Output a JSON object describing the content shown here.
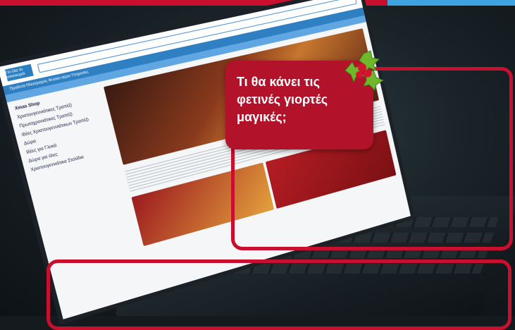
{
  "hero": {
    "headline": "Τι θα κάνει τις φετινές γιορτές μαγικές;"
  },
  "screen": {
    "logo": "Για όλα τα νοικοκυριά",
    "search_placeholder": "",
    "nav": "Προϊόντα  Ηλεκτρισμός  Φυσικό αέριο  Υπηρεσίες",
    "side_heading": "Xmas Shop",
    "side_items": [
      "Χριστουγεννιάτικες Τραπέζι",
      "Πρωτοχρονιάτικες Τραπέζι",
      "Ιδέες Χριστουγεννιάτικων Τραπέζι",
      "Δώρα",
      "Ιδέες για Γλυκά",
      "Δώρα για όλες",
      "Χριστουγεννιάτικα Στολίδια"
    ]
  },
  "colors": {
    "brand_red": "#c8102e",
    "brand_blue": "#3fa3e0"
  }
}
